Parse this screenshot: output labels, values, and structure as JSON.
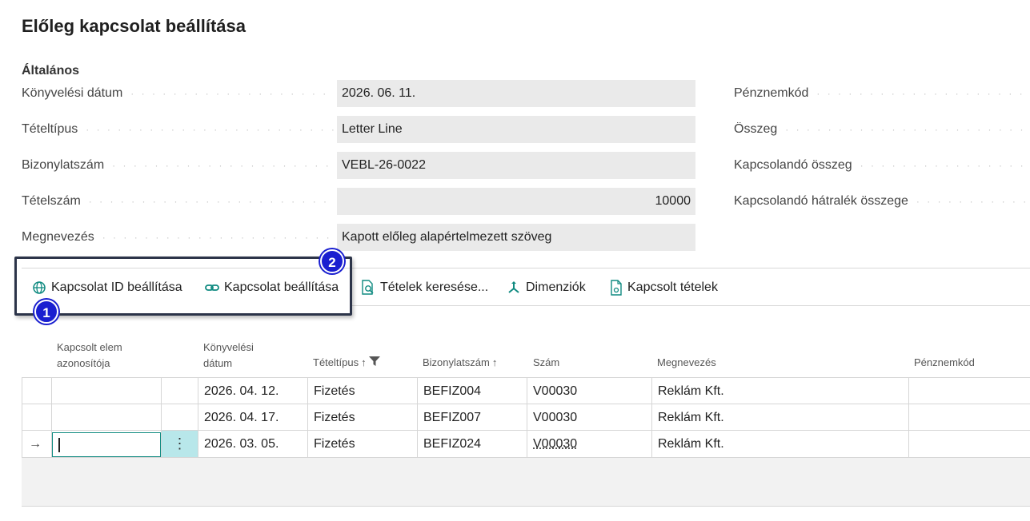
{
  "page": {
    "title": "Előleg kapcsolat beállítása",
    "section": "Általános"
  },
  "fields_left": [
    {
      "label": "Könyvelési dátum",
      "value": "2026. 06. 11."
    },
    {
      "label": "Tételtípus",
      "value": "Letter Line"
    },
    {
      "label": "Bizonylatszám",
      "value": "VEBL-26-0022"
    },
    {
      "label": "Tételszám",
      "value": "10000"
    },
    {
      "label": "Megnevezés",
      "value": "Kapott előleg alapértelmezett szöveg"
    }
  ],
  "fields_right": [
    {
      "label": "Pénznemkód"
    },
    {
      "label": "Összeg"
    },
    {
      "label": "Kapcsolandó összeg"
    },
    {
      "label": "Kapcsolandó hátralék összege"
    }
  ],
  "actions": [
    {
      "label": "Kapcsolat ID beállítása",
      "icon": "globe-icon"
    },
    {
      "label": "Kapcsolat beállítása",
      "icon": "link-icon"
    },
    {
      "label": "Tételek keresése...",
      "icon": "find-entries-icon"
    },
    {
      "label": "Dimenziók",
      "icon": "dimensions-icon"
    },
    {
      "label": "Kapcsolt tételek",
      "icon": "document-icon"
    }
  ],
  "badges": [
    "1",
    "2"
  ],
  "table": {
    "headers": {
      "linked_id_1": "Kapcsolt elem",
      "linked_id_2": "azonosítója",
      "posting_date_1": "Könyvelési",
      "posting_date_2": "dátum",
      "entry_type": "Tételtípus",
      "doc_no": "Bizonylatszám",
      "number": "Szám",
      "description": "Megnevezés",
      "currency": "Pénznemkód"
    },
    "rows": [
      {
        "date": "2026. 04. 12.",
        "type": "Fizetés",
        "doc": "BEFIZ004",
        "num": "V00030",
        "desc": "Reklám Kft."
      },
      {
        "date": "2026. 04. 17.",
        "type": "Fizetés",
        "doc": "BEFIZ007",
        "num": "V00030",
        "desc": "Reklám Kft."
      },
      {
        "date": "2026. 03. 05.",
        "type": "Fizetés",
        "doc": "BEFIZ024",
        "num": "V00030",
        "desc": "Reklám Kft."
      }
    ]
  },
  "colors": {
    "accent": "#1a1fd0",
    "teal": "#0f8a80",
    "field_bg": "#eaeaea",
    "highlight_border": "#2c3449"
  }
}
